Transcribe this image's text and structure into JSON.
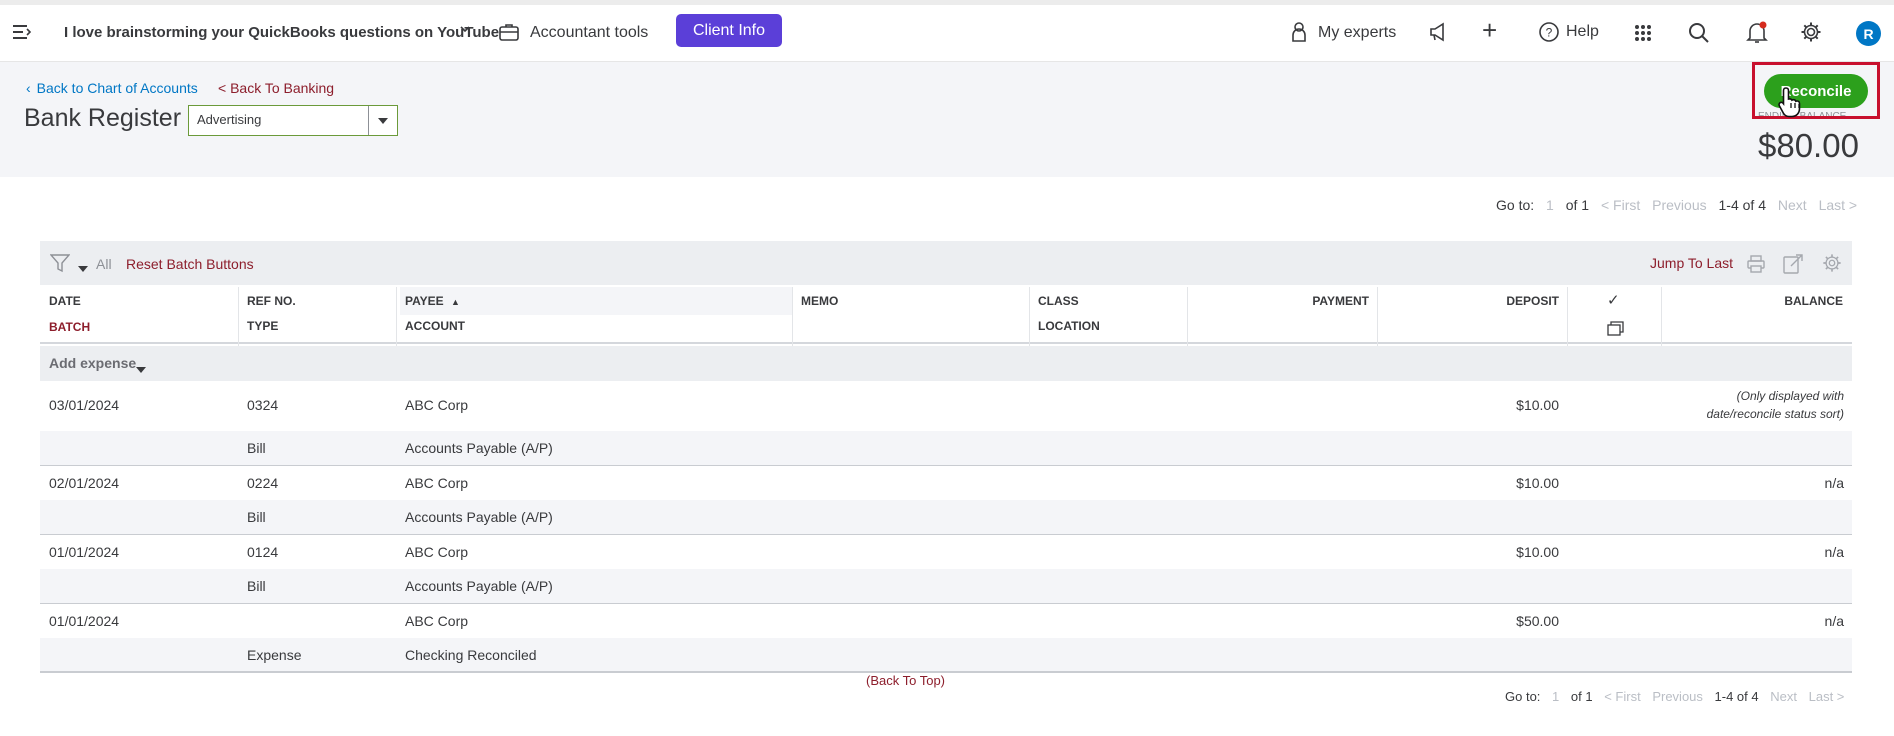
{
  "topbar": {
    "company_name": "I love brainstorming your QuickBooks questions on YouTube",
    "accountant_tools": "Accountant tools",
    "client_info": "Client Info",
    "my_experts": "My experts",
    "help": "Help",
    "avatar_initial": "R",
    "plus_label": "+",
    "icons": [
      "menu-icon",
      "briefcase-icon",
      "person-icon",
      "megaphone-icon",
      "help-icon",
      "apps-grid-icon",
      "search-icon",
      "bell-icon",
      "gear-icon"
    ],
    "notification_color": "#d52b1e"
  },
  "header": {
    "back_to_coa": "Back to Chart of Accounts",
    "back_to_banking": "< Back To Banking",
    "title": "Bank Register",
    "account_selected": "Advertising",
    "reconcile_label": "Reconcile",
    "ending_balance_label": "ENDING BALANCE",
    "ending_balance": "$80.00"
  },
  "pager": {
    "goto_label": "Go to:",
    "page": "1",
    "of": "of 1",
    "first": "< First",
    "previous": "Previous",
    "range": "1-4 of 4",
    "next": "Next",
    "last": "Last >"
  },
  "toolbar": {
    "all": "All",
    "reset_batch": "Reset Batch Buttons",
    "jump_to_last": "Jump To Last"
  },
  "columns": {
    "date": "DATE",
    "batch": "BATCH",
    "ref_no": "REF NO.",
    "type": "TYPE",
    "payee": "PAYEE",
    "account": "ACCOUNT",
    "memo": "MEMO",
    "class": "CLASS",
    "location": "LOCATION",
    "payment": "PAYMENT",
    "deposit": "DEPOSIT",
    "check": "✓",
    "balance": "BALANCE"
  },
  "add_expense": "Add expense",
  "rows": [
    {
      "date": "03/01/2024",
      "ref": "0324",
      "payee": "ABC Corp",
      "deposit": "$10.00",
      "balance": "(Only displayed with date/reconcile status sort)",
      "type": "Bill",
      "account": "Accounts Payable (A/P)"
    },
    {
      "date": "02/01/2024",
      "ref": "0224",
      "payee": "ABC Corp",
      "deposit": "$10.00",
      "balance": "n/a",
      "type": "Bill",
      "account": "Accounts Payable (A/P)"
    },
    {
      "date": "01/01/2024",
      "ref": "0124",
      "payee": "ABC Corp",
      "deposit": "$10.00",
      "balance": "n/a",
      "type": "Bill",
      "account": "Accounts Payable (A/P)"
    },
    {
      "date": "01/01/2024",
      "ref": "",
      "payee": "ABC Corp",
      "deposit": "$50.00",
      "balance": "n/a",
      "type": "Expense",
      "account": "Checking Reconciled"
    }
  ],
  "back_to_top": "(Back To Top)",
  "colors": {
    "brand_green": "#2ca01c",
    "client_info_purple": "#5b3fd8",
    "link_blue": "#0077c5",
    "link_maroon": "#8d1e2c",
    "highlight_red": "#c8102e"
  }
}
